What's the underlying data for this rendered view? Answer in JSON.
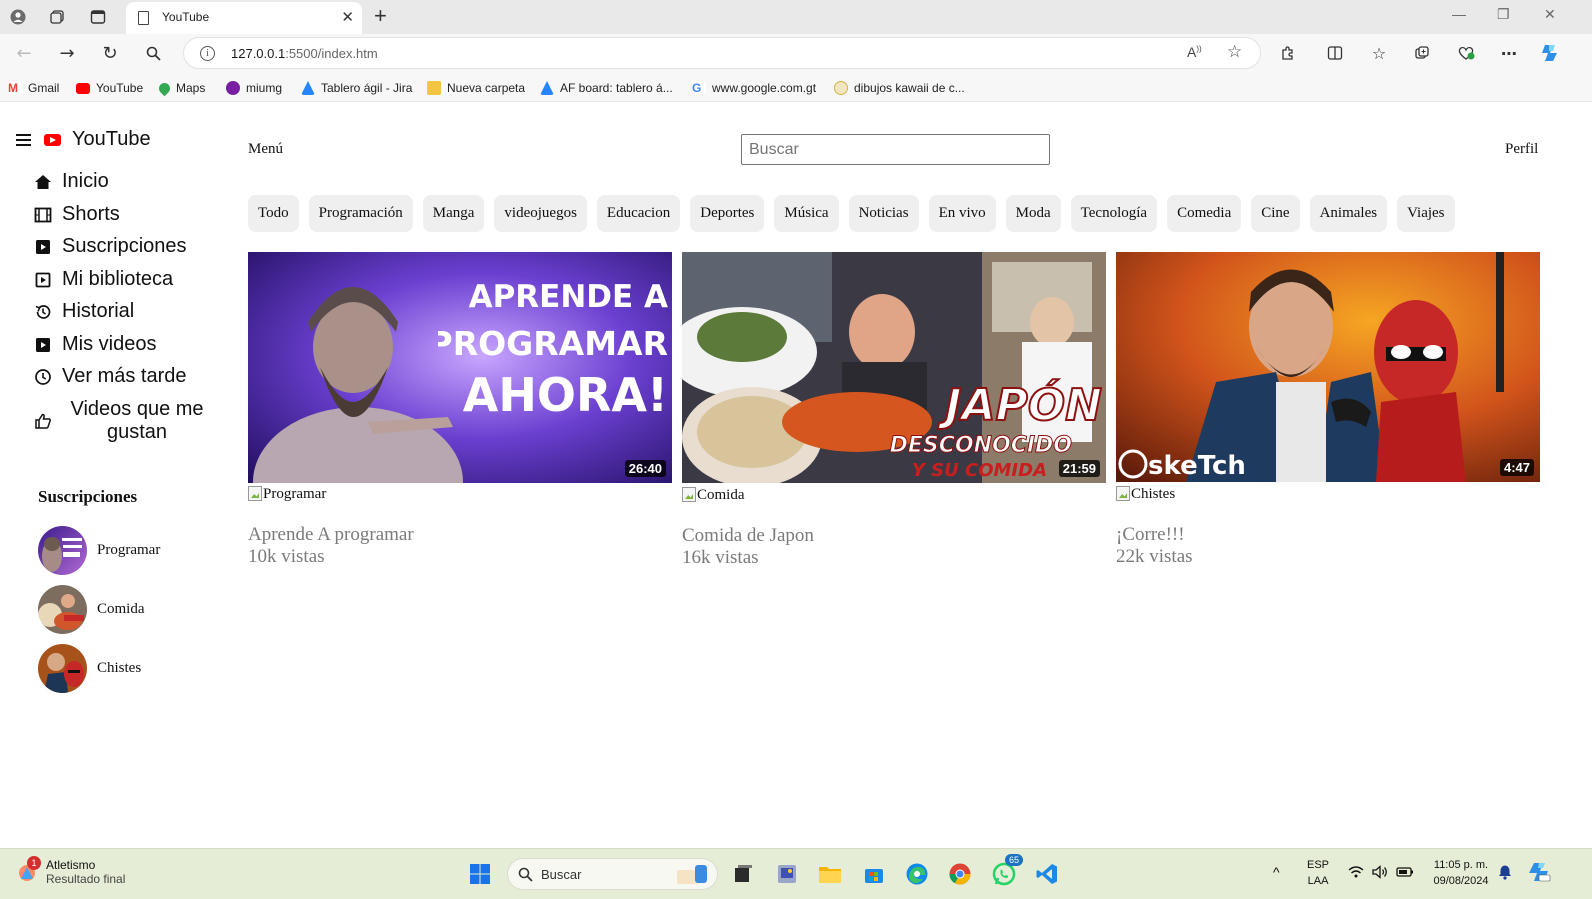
{
  "browser": {
    "tab_title": "YouTube",
    "url_host": "127.0.0.1",
    "url_rest": ":5500/index.htm",
    "bookmarks": [
      {
        "label": "Gmail",
        "color": "#ea4335"
      },
      {
        "label": "YouTube",
        "color": "#ff0000"
      },
      {
        "label": "Maps",
        "color": "#34a853"
      },
      {
        "label": "miumg",
        "color": "#7b1fa2"
      },
      {
        "label": "Tablero ágil - Jira",
        "color": "#2684ff"
      },
      {
        "label": "Nueva carpeta",
        "color": "#f4c542"
      },
      {
        "label": "AF board: tablero á...",
        "color": "#2684ff"
      },
      {
        "label": "www.google.com.gt",
        "color": "#4285f4"
      },
      {
        "label": "dibujos kawaii de c...",
        "color": "#f2c94c"
      }
    ]
  },
  "sidebar": {
    "brand": "YouTube",
    "items": [
      {
        "label": "Inicio",
        "icon": "home-icon"
      },
      {
        "label": "Shorts",
        "icon": "shorts-icon"
      },
      {
        "label": "Suscripciones",
        "icon": "subscriptions-icon"
      },
      {
        "label": "Mi biblioteca",
        "icon": "library-icon"
      },
      {
        "label": "Historial",
        "icon": "history-icon"
      },
      {
        "label": "Mis videos",
        "icon": "my-videos-icon"
      },
      {
        "label": "Ver más tarde",
        "icon": "watch-later-icon"
      },
      {
        "label": "Videos que me gustan",
        "icon": "thumbs-up-icon"
      }
    ],
    "subs_title": "Suscripciones",
    "subscriptions": [
      {
        "name": "Programar"
      },
      {
        "name": "Comida"
      },
      {
        "name": "Chistes"
      }
    ]
  },
  "header": {
    "menu_label": "Menú",
    "search_placeholder": "Buscar",
    "profile_label": "Perfil"
  },
  "chips": [
    "Todo",
    "Programación",
    "Manga",
    "videojuegos",
    "Educacion",
    "Deportes",
    "Música",
    "Noticias",
    "En vivo",
    "Moda",
    "Tecnología",
    "Comedia",
    "Cine",
    "Animales",
    "Viajes"
  ],
  "videos": [
    {
      "duration": "26:40",
      "alt": "Programar",
      "title": "Aprende A programar",
      "views": "10k vistas",
      "overlay": [
        "APRENDE A",
        "PROGRAMAR",
        "AHORA!"
      ]
    },
    {
      "duration": "21:59",
      "alt": "Comida",
      "title": "Comida de Japon",
      "views": "16k vistas",
      "overlay": [
        "JAPÓN",
        "DESCONOCIDO",
        "Y SU COMIDA"
      ]
    },
    {
      "duration": "4:47",
      "alt": "Chistes",
      "title": "¡Corre!!!",
      "views": "22k vistas",
      "overlay": [
        "skeTch"
      ]
    }
  ],
  "taskbar": {
    "weather_title": "Atletismo",
    "weather_sub": "Resultado final",
    "weather_badge": "1",
    "search_label": "Buscar",
    "whatsapp_badge": "65",
    "lang1": "ESP",
    "lang2": "LAA",
    "time": "11:05 p. m.",
    "date": "09/08/2024"
  }
}
